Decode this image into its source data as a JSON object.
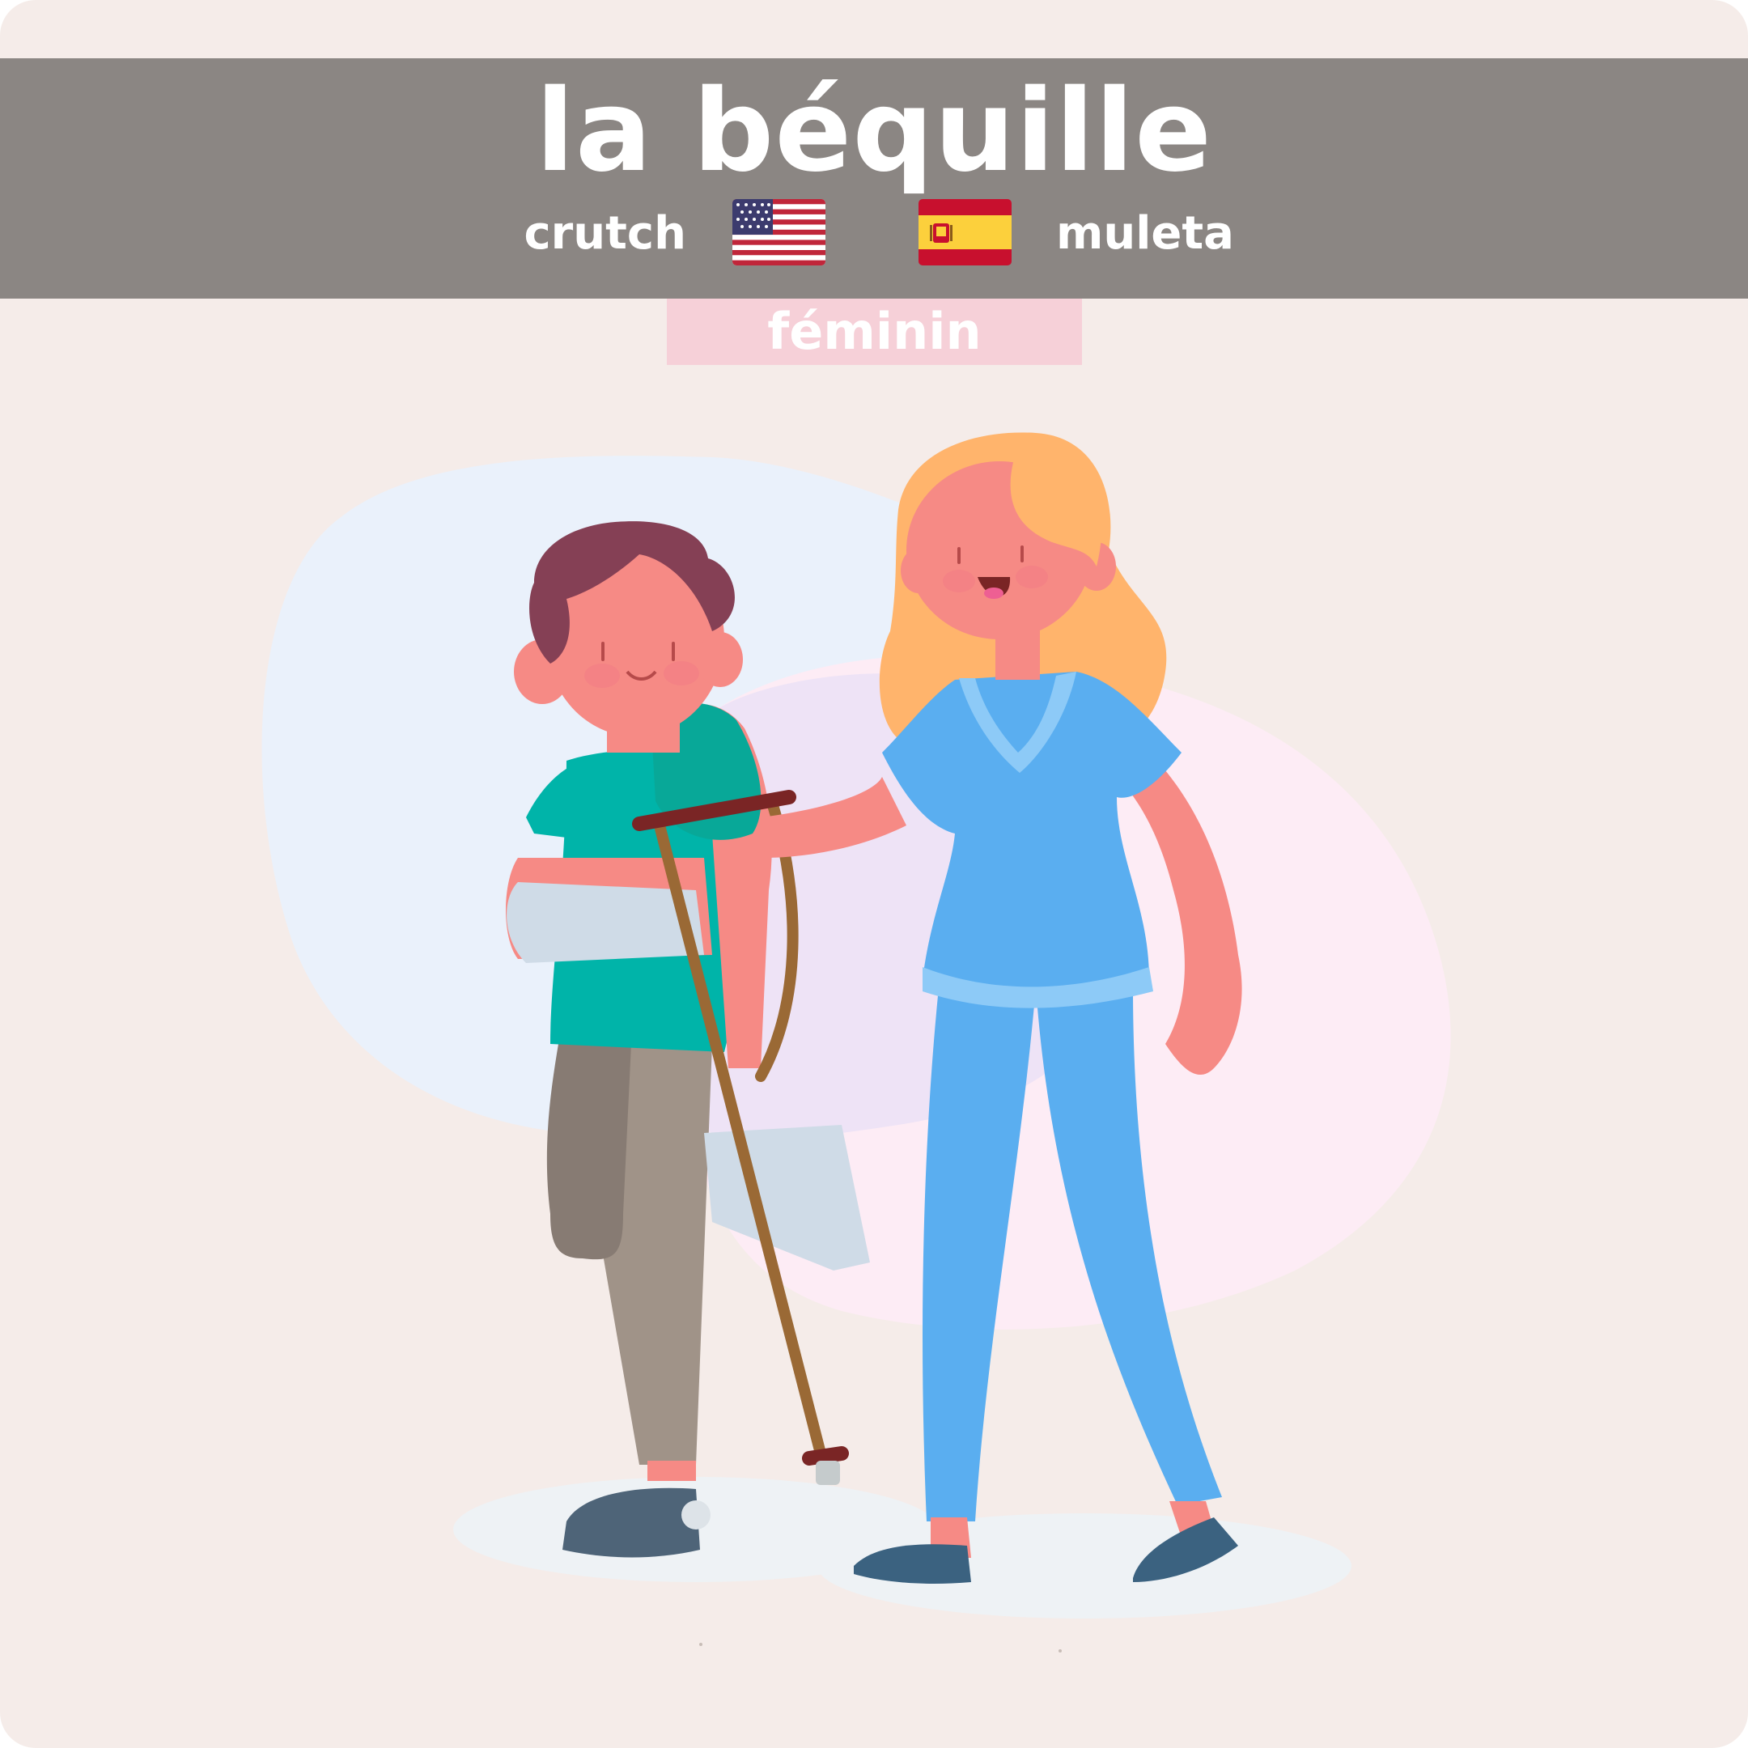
{
  "card": {
    "word": "la béquille",
    "translations": {
      "english": "crutch",
      "spanish": "muleta"
    },
    "gender": "féminin"
  },
  "icons": {
    "english_flag": "us-flag-icon",
    "spanish_flag": "spain-flag-icon"
  },
  "colors": {
    "background": "#f5ece9",
    "header": "#8b8683",
    "gender_badge": "#f6d0d8",
    "text": "#ffffff"
  }
}
